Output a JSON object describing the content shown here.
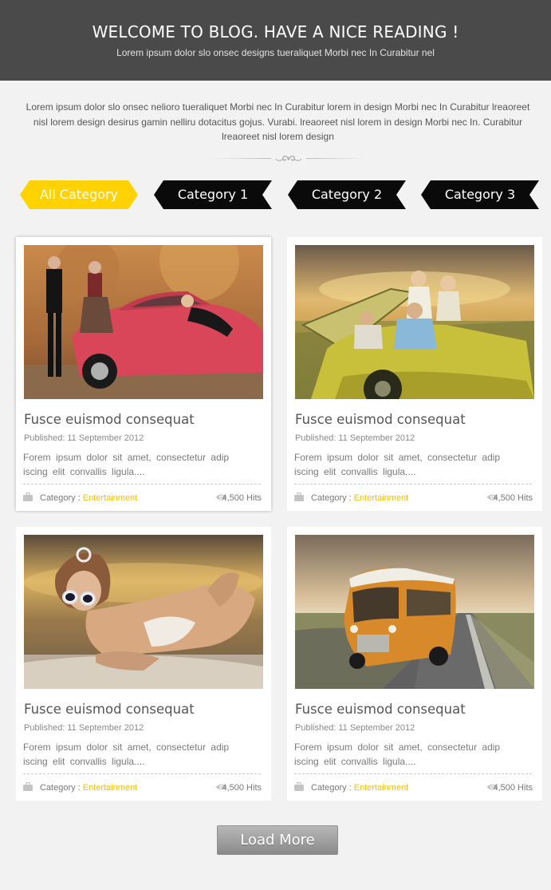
{
  "header": {
    "title": "WELCOME TO BLOG. HAVE A NICE READING !",
    "subtitle": "Lorem ipsum dolor slo onsec designs tueraliquet Morbi nec In Curabitur nel"
  },
  "intro": {
    "line1": "Lorem ipsum dolor slo onsec nelioro tueraliquet Morbi nec In Curabitur lorem in design Morbi nec In Curabitur lreaoreet",
    "line2": "nisl lorem design desirus gamin nelliru dotacitus gojus. Vurabi. lreaoreet nisl lorem in design Morbi nec In. Curabitur",
    "line3": "lreaoreet nisl lorem design"
  },
  "categories": [
    {
      "label": "All Category",
      "active": true
    },
    {
      "label": "Category 1",
      "active": false
    },
    {
      "label": "Category 2",
      "active": false
    },
    {
      "label": "Category 3",
      "active": false
    }
  ],
  "posts": [
    {
      "title": "Fusce euismod consequat",
      "published_label": "Published:",
      "published_date": "11 September 2012",
      "excerpt_1": "Forem ipsum dolor sit amet, consectetur adip",
      "excerpt_2": "iscing elit convallis ligula....",
      "category_label": "Category :",
      "category": "Entertainment",
      "hits": "4,500 Hits",
      "image": "vintage-red-car-couple-photo"
    },
    {
      "title": "Fusce euismod consequat",
      "published_label": "Published:",
      "published_date": "11 September 2012",
      "excerpt_1": "Forem ipsum dolor sit amet, consectetur adip",
      "excerpt_2": "iscing elit convallis ligula....",
      "category_label": "Category :",
      "category": "Entertainment",
      "hits": "4,500 Hits",
      "image": "friends-in-convertible-photo"
    },
    {
      "title": "Fusce euismod consequat",
      "published_label": "Published:",
      "published_date": "11 September 2012",
      "excerpt_1": "Forem ipsum dolor sit amet, consectetur adip",
      "excerpt_2": "iscing elit convallis ligula....",
      "category_label": "Category :",
      "category": "Entertainment",
      "hits": "4,500 Hits",
      "image": "woman-sunglasses-beach-photo"
    },
    {
      "title": "Fusce euismod consequat",
      "published_label": "Published:",
      "published_date": "11 September 2012",
      "excerpt_1": "Forem ipsum dolor sit amet, consectetur adip",
      "excerpt_2": "iscing elit convallis ligula....",
      "category_label": "Category :",
      "category": "Entertainment",
      "hits": "4,500 Hits",
      "image": "orange-bus-road-photo"
    }
  ],
  "load_more": "Load More",
  "colors": {
    "header_bg": "#4a4a4a",
    "accent": "#ffd200",
    "category_link": "#f3c000",
    "page_bg": "#f2f2f2"
  }
}
